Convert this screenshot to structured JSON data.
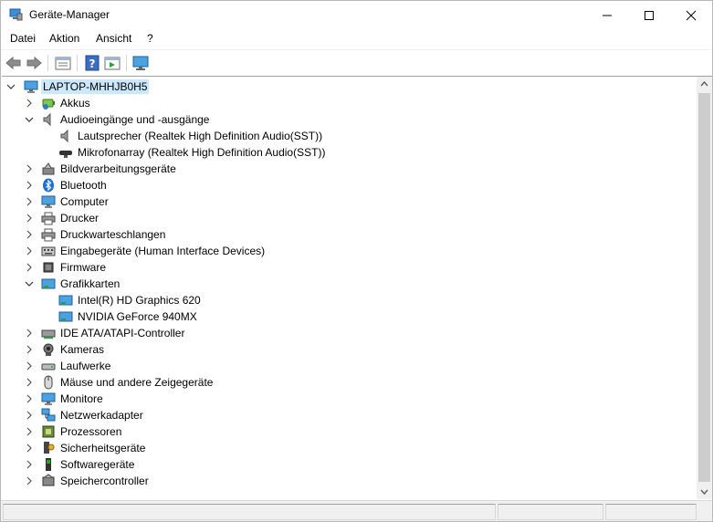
{
  "window": {
    "title": "Geräte-Manager"
  },
  "menu": [
    "Datei",
    "Aktion",
    "Ansicht",
    "?"
  ],
  "toolbar": {
    "buttons": [
      "back-icon",
      "forward-icon",
      "properties-icon",
      "help-icon",
      "run-icon",
      "monitor-scan-icon"
    ]
  },
  "tree": {
    "root": {
      "label": "LAPTOP-MHHJB0H5",
      "icon": "computer-icon"
    },
    "nodes": [
      {
        "label": "Akkus",
        "icon": "battery-icon",
        "expanded": false
      },
      {
        "label": "Audioeingänge und -ausgänge",
        "icon": "speaker-icon",
        "expanded": true
      },
      {
        "label": "Lautsprecher (Realtek High Definition Audio(SST))",
        "icon": "speaker-icon",
        "child": true
      },
      {
        "label": "Mikrofonarray (Realtek High Definition Audio(SST))",
        "icon": "microphone-icon",
        "child": true
      },
      {
        "label": "Bildverarbeitungsgeräte",
        "icon": "camera-device-icon",
        "expanded": false
      },
      {
        "label": "Bluetooth",
        "icon": "bluetooth-icon",
        "expanded": false
      },
      {
        "label": "Computer",
        "icon": "monitor-icon",
        "expanded": false
      },
      {
        "label": "Drucker",
        "icon": "printer-icon",
        "expanded": false
      },
      {
        "label": "Druckwarteschlangen",
        "icon": "printer-icon",
        "expanded": false
      },
      {
        "label": "Eingabegeräte (Human Interface Devices)",
        "icon": "keyboard-icon",
        "expanded": false
      },
      {
        "label": "Firmware",
        "icon": "chip-icon",
        "expanded": false
      },
      {
        "label": "Grafikkarten",
        "icon": "display-adapter-icon",
        "expanded": true
      },
      {
        "label": "Intel(R) HD Graphics 620",
        "icon": "display-adapter-icon",
        "child": true
      },
      {
        "label": "NVIDIA GeForce 940MX",
        "icon": "display-adapter-icon",
        "child": true
      },
      {
        "label": "IDE ATA/ATAPI-Controller",
        "icon": "ide-controller-icon",
        "expanded": false
      },
      {
        "label": "Kameras",
        "icon": "webcam-icon",
        "expanded": false
      },
      {
        "label": "Laufwerke",
        "icon": "drive-icon",
        "expanded": false
      },
      {
        "label": "Mäuse und andere Zeigegeräte",
        "icon": "mouse-icon",
        "expanded": false
      },
      {
        "label": "Monitore",
        "icon": "monitor-icon",
        "expanded": false
      },
      {
        "label": "Netzwerkadapter",
        "icon": "network-icon",
        "expanded": false
      },
      {
        "label": "Prozessoren",
        "icon": "processor-icon",
        "expanded": false
      },
      {
        "label": "Sicherheitsgeräte",
        "icon": "security-key-icon",
        "expanded": false
      },
      {
        "label": "Softwaregeräte",
        "icon": "software-device-icon",
        "expanded": false
      },
      {
        "label": "Speichercontroller",
        "icon": "storage-controller-icon",
        "expanded": false
      }
    ]
  },
  "colors": {
    "selection": "#cce8ff",
    "accent": "#0078d7"
  }
}
